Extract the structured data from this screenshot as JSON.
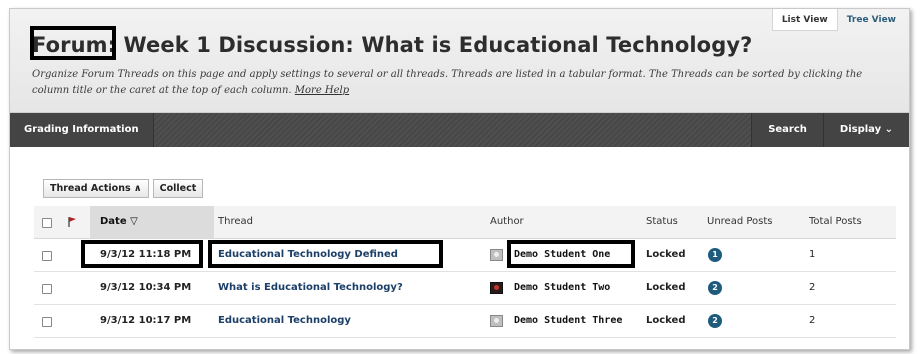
{
  "header": {
    "view_tabs": {
      "list_view": "List View",
      "tree_view": "Tree View"
    },
    "title": "Forum: Week 1 Discussion: What is Educational Technology?",
    "description": "Organize Forum Threads on this page and apply settings to several or all threads. Threads are listed in a tabular format. The Threads can be sorted by clicking the column title or the caret at the top of each column.",
    "more_help": "More Help"
  },
  "action_bar": {
    "grading_information": "Grading Information",
    "search": "Search",
    "display": "Display ⌄"
  },
  "controls": {
    "thread_actions": "Thread Actions ∧",
    "collect": "Collect"
  },
  "table": {
    "columns": {
      "date": "Date ▽",
      "thread": "Thread",
      "author": "Author",
      "status": "Status",
      "unread": "Unread Posts",
      "total": "Total Posts"
    },
    "rows": [
      {
        "date": "9/3/12 11:18 PM",
        "thread": "Educational Technology Defined",
        "author": "Demo Student One",
        "status": "Locked",
        "unread": "1",
        "total": "1"
      },
      {
        "date": "9/3/12 10:34 PM",
        "thread": "What is Educational Technology?",
        "author": "Demo Student Two",
        "status": "Locked",
        "unread": "2",
        "total": "2"
      },
      {
        "date": "9/3/12 10:17 PM",
        "thread": "Educational Technology",
        "author": "Demo Student Three",
        "status": "Locked",
        "unread": "2",
        "total": "2"
      }
    ]
  },
  "colors": {
    "accent": "#1f5b7d",
    "link": "#1c3f68",
    "bar": "#4a4a4a"
  },
  "icons": [
    "checkbox",
    "flag-icon",
    "avatar-icon",
    "unread-badge"
  ]
}
